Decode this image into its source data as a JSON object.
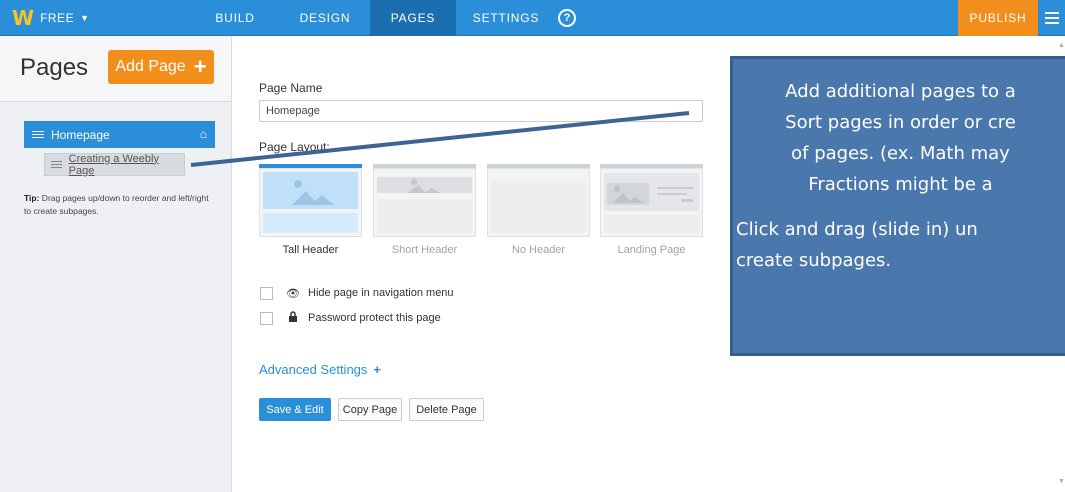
{
  "topbar": {
    "plan": "FREE",
    "tabs": [
      "BUILD",
      "DESIGN",
      "PAGES",
      "SETTINGS"
    ],
    "active_tab": "PAGES",
    "help_label": "?",
    "publish": "PUBLISH",
    "accent": "#2a8fd8",
    "publish_color": "#f28e1c"
  },
  "sidebar": {
    "title": "Pages",
    "add_button": "Add Page",
    "add_plus": "+",
    "pages": [
      "Homepage",
      "Creating a Weebly Page"
    ],
    "tip_label": "Tip:",
    "tip_text": " Drag pages up/down to reorder and left/right to create subpages."
  },
  "main": {
    "page_name_label": "Page Name",
    "page_name_value": "Homepage",
    "layout_label": "Page Layout:",
    "layouts": [
      "Tall Header",
      "Short Header",
      "No Header",
      "Landing Page"
    ],
    "selected_layout": "Tall Header",
    "options": [
      "Hide page in navigation menu",
      "Password protect this page"
    ],
    "advanced": "Advanced Settings",
    "advanced_plus": "+",
    "buttons": [
      "Save & Edit",
      "Copy Page",
      "Delete Page"
    ]
  },
  "callout": {
    "lines": [
      "Add additional pages to a",
      "Sort pages in order or cre",
      "of pages. (ex. Math may",
      "Fractions might be a",
      "Click and drag (slide in) un",
      "create subpages."
    ],
    "bg_color": "#4a77ac"
  }
}
